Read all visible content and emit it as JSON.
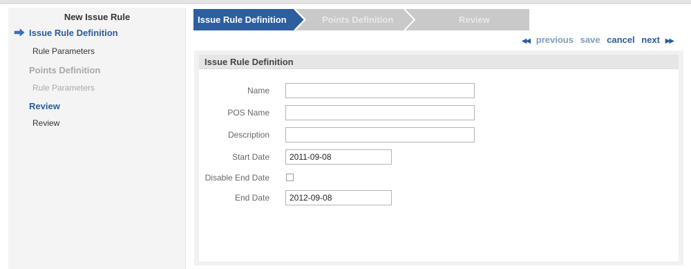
{
  "sidebar": {
    "title": "New Issue Rule",
    "items": [
      {
        "label": "Issue Rule Definition"
      },
      {
        "label": "Rule Parameters"
      },
      {
        "label": "Points Definition"
      },
      {
        "label": "Rule Parameters"
      },
      {
        "label": "Review"
      },
      {
        "label": "Review"
      }
    ]
  },
  "tabs": [
    {
      "label": "Issue Rule Definition",
      "state": "active"
    },
    {
      "label": "Points Definition",
      "state": "inactive"
    },
    {
      "label": "Review",
      "state": "inactive"
    }
  ],
  "nav": {
    "previous": "previous",
    "save": "save",
    "cancel": "cancel",
    "next": "next"
  },
  "panel": {
    "title": "Issue Rule Definition"
  },
  "form": {
    "name": {
      "label": "Name",
      "value": ""
    },
    "pos_name": {
      "label": "POS Name",
      "value": ""
    },
    "description": {
      "label": "Description",
      "value": ""
    },
    "start_date": {
      "label": "Start Date",
      "value": "2011-09-08"
    },
    "disable_end_date": {
      "label": "Disable End Date",
      "checked": false
    },
    "end_date": {
      "label": "End Date",
      "value": "2012-09-08"
    }
  },
  "colors": {
    "accent": "#2a5c9a",
    "tab_active": "#2d5e9e",
    "tab_inactive": "#c9c9c9",
    "disabled_text": "#a8a8a8"
  },
  "icons": {
    "current_step": "arrow-right-icon",
    "previous": "double-left-arrow-icon",
    "next": "double-right-arrow-icon"
  }
}
